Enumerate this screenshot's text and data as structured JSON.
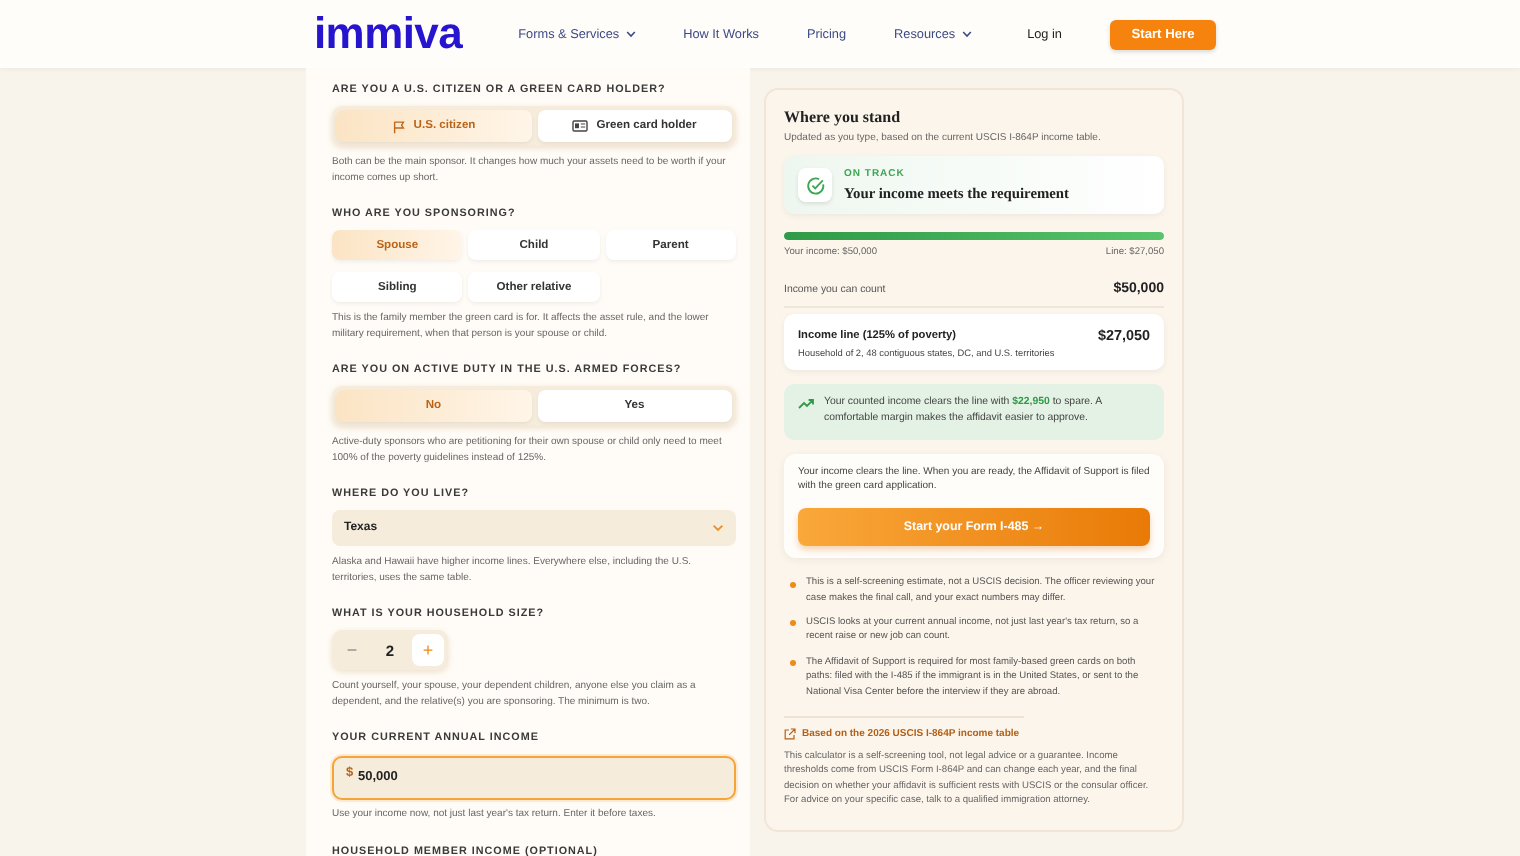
{
  "header": {
    "logo": "immiva",
    "nav": [
      {
        "label": "Forms & Services",
        "dropdown": true
      },
      {
        "label": "How It Works",
        "dropdown": false
      },
      {
        "label": "Pricing",
        "dropdown": false
      },
      {
        "label": "Resources",
        "dropdown": true
      }
    ],
    "login": "Log in",
    "cta": "Start Here"
  },
  "form": {
    "sections": [
      {
        "kind": "toggle",
        "question": "ARE YOU A U.S. CITIZEN OR A GREEN CARD HOLDER?",
        "icons": true,
        "options": [
          {
            "label": "U.S. citizen",
            "selected": true
          },
          {
            "label": "Green card holder",
            "selected": false
          }
        ],
        "note": "Both can be the main sponsor. It changes how much your assets need to be worth if your income comes up short."
      },
      {
        "kind": "choices",
        "question": "WHO ARE YOU SPONSORING?",
        "options": [
          {
            "label": "Spouse",
            "selected": true
          },
          {
            "label": "Child",
            "selected": false
          },
          {
            "label": "Parent",
            "selected": false
          },
          {
            "label": "Sibling",
            "selected": false
          },
          {
            "label": "Other relative",
            "selected": false
          }
        ],
        "note": "This is the family member the green card is for. It affects the asset rule, and the lower military requirement, when that person is your spouse or child."
      },
      {
        "kind": "toggle",
        "question": "ARE YOU ON ACTIVE DUTY IN THE U.S. ARMED FORCES?",
        "icons": false,
        "options": [
          {
            "label": "No",
            "selected": true
          },
          {
            "label": "Yes",
            "selected": false
          }
        ],
        "note": "Active-duty sponsors who are petitioning for their own spouse or child only need to meet 100% of the poverty guidelines instead of 125%."
      },
      {
        "kind": "select",
        "question": "WHERE DO YOU LIVE?",
        "value": "Texas",
        "note": "Alaska and Hawaii have higher income lines. Everywhere else, including the U.S. territories, uses the same table."
      },
      {
        "kind": "stepper",
        "question": "WHAT IS YOUR HOUSEHOLD SIZE?",
        "minus": "−",
        "plus": "+",
        "minus_disabled": true,
        "value": "2",
        "note": "Count yourself, your spouse, your dependent children, anyone else you claim as a dependent, and the relative(s) you are sponsoring. The minimum is two."
      },
      {
        "kind": "input",
        "question": "YOUR CURRENT ANNUAL INCOME",
        "prefix": "$",
        "value": "50,000",
        "focused": true,
        "note": "Use your income now, not just last year's tax return. Enter it before taxes."
      },
      {
        "kind": "heading",
        "question": "HOUSEHOLD MEMBER INCOME (OPTIONAL)"
      }
    ]
  },
  "result": {
    "title": "Where you stand",
    "subtitle": "Updated as you type, based on the current USCIS I-864P income table.",
    "status": {
      "label": "ON TRACK",
      "headline": "Your income meets the requirement"
    },
    "progress": {
      "level": 1.0,
      "left": "Your income: $50,000",
      "right": "Line: $27,050"
    },
    "count": {
      "label": "Income you can count",
      "value": "$50,000"
    },
    "line": {
      "label": "Income line (125% of poverty)",
      "value": "$27,050",
      "detail": "Household of 2, 48 contiguous states, DC, and U.S. territories"
    },
    "margin": "Your counted income clears the line with **$22,950** to spare. A comfortable margin makes the affidavit easier to approve.",
    "action": {
      "text": "Your income clears the line. When you are ready, the Affidavit of Support is filed with the green card application.",
      "button": "Start your Form I-485 →"
    },
    "bullets": [
      "This is a self-screening estimate, not a USCIS decision. The officer reviewing your case makes the final call, and your exact numbers may differ.",
      "USCIS looks at your current annual income, not just last year's tax return, so a recent raise or new job can count.",
      "The Affidavit of Support is required for most family-based green cards on both paths: filed with the I-485 if the immigrant is in the United States, or sent to the National Visa Center before the interview if they are abroad."
    ],
    "source": "Based on the 2026 USCIS I-864P income table",
    "disclaimer": "This calculator is a self-screening tool, not legal advice or a guarantee. Income thresholds come from USCIS Form I-864P and can change each year, and the final decision on whether your affidavit is sufficient rests with USCIS or the consular officer. For advice on your specific case, talk to a qualified immigration attorney."
  }
}
